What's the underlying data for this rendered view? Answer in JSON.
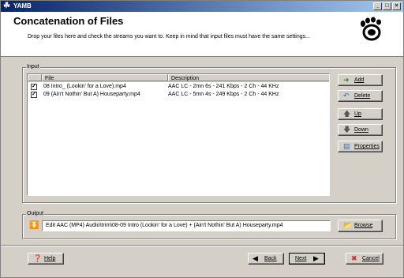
{
  "window": {
    "title": "YAMB",
    "app_icon": "gnome-foot-icon",
    "controls": {
      "minimize": "_",
      "maximize": "□",
      "close": "×"
    }
  },
  "header": {
    "title": "Concatenation of Files",
    "subtitle": "Drop your files here and check the streams you want to. Keep in mind that input files must have the same settings..."
  },
  "input": {
    "group_label": "Input",
    "columns": [
      "File",
      "Description"
    ],
    "rows": [
      {
        "checked": true,
        "file": "08 Intro_ (Lookin' for a Love).mp4",
        "description": "AAC LC - 2mn 6s - 241 Kbps - 2 Ch - 44 KHz"
      },
      {
        "checked": true,
        "file": "09 (Ain't Nothin' But A) Houseparty.mp4",
        "description": "AAC LC - 5mn 4s - 249 Kbps - 2 Ch - 44 KHz"
      }
    ],
    "buttons": {
      "add": "Add",
      "delete": "Delete",
      "up": "Up",
      "down": "Down",
      "properties": "Properties"
    }
  },
  "output": {
    "group_label": "Output",
    "path": "Edit AAC (MP4) Audio\\trim\\08-09 Intro (Lookin' for a Love) + (Ain't Nothin' But A) Houseparty.mp4",
    "browse": "Browse"
  },
  "footer": {
    "help": "Help",
    "back": "Back",
    "next": "Next",
    "cancel": "Cancel"
  },
  "colors": {
    "titlebar_start": "#0a246a",
    "titlebar_end": "#a6caf0",
    "face": "#d4d0c8"
  }
}
